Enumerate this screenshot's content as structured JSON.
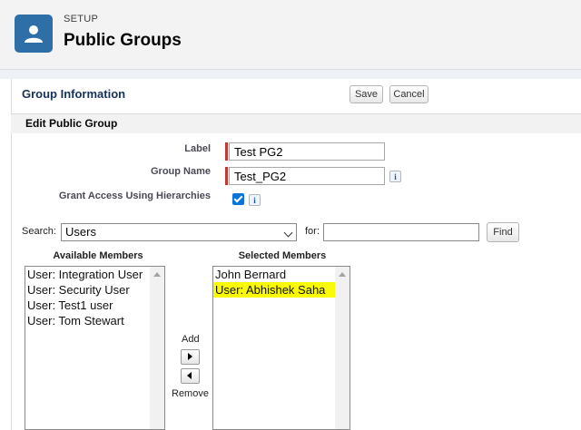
{
  "header": {
    "eyebrow": "SETUP",
    "title": "Public Groups",
    "icon": "user-icon"
  },
  "page_block": {
    "title": "Group Information",
    "save_label": "Save",
    "cancel_label": "Cancel"
  },
  "section": {
    "title": "Edit Public Group"
  },
  "form": {
    "label_label": "Label",
    "label_value": "Test PG2",
    "group_name_label": "Group Name",
    "group_name_value": "Test_PG2",
    "grant_access_label": "Grant Access Using Hierarchies",
    "grant_access_checked": true,
    "info_glyph": "i"
  },
  "search": {
    "search_label": "Search:",
    "search_type": "Users",
    "for_label": "for:",
    "for_value": "",
    "find_label": "Find"
  },
  "available": {
    "title": "Available Members",
    "items": [
      "User: Integration User",
      "User: Security User",
      "User: Test1 user",
      "User: Tom Stewart"
    ]
  },
  "selected": {
    "title": "Selected Members",
    "items": [
      "John Bernard",
      "User: Abhishek Saha"
    ]
  },
  "mover": {
    "add_label": "Add",
    "remove_label": "Remove"
  },
  "colors": {
    "required": "#c23934",
    "header_icon": "#2f6fa8",
    "highlight": "#fafa00",
    "checkbox": "#0b74d9"
  }
}
